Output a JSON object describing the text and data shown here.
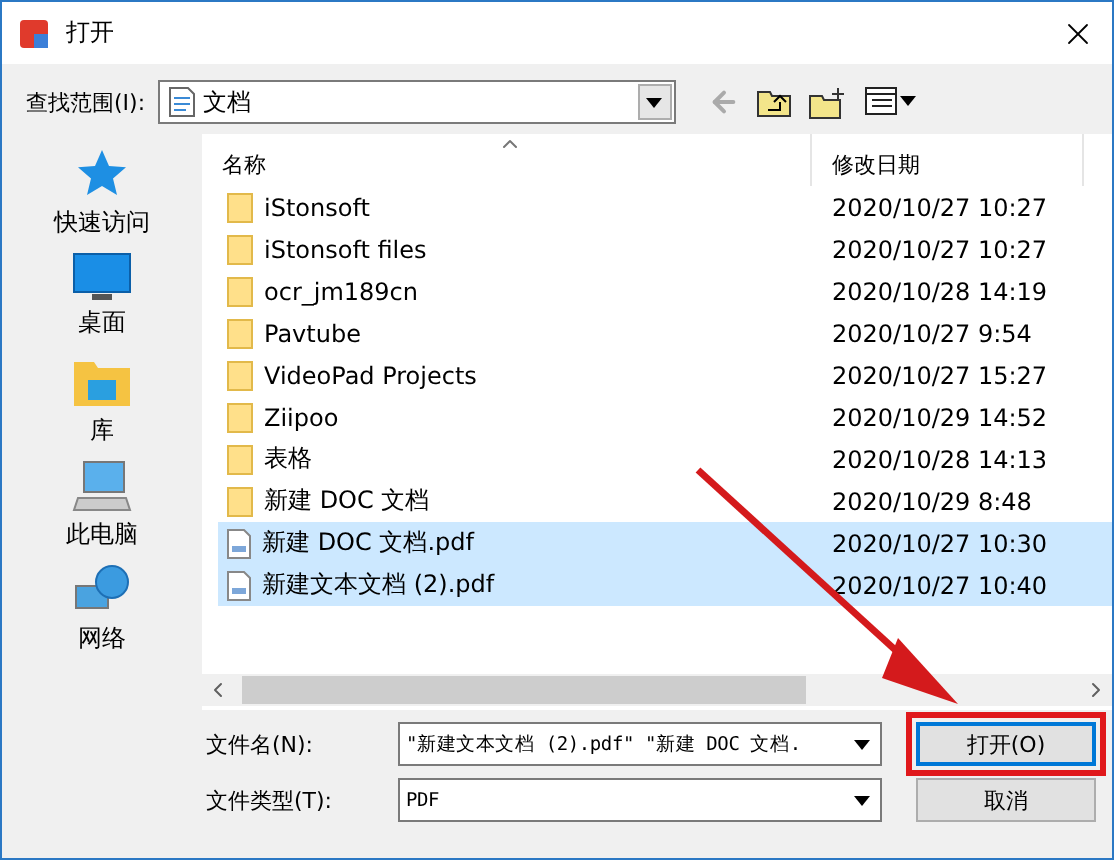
{
  "window": {
    "title": "打开"
  },
  "look_in": {
    "label": "查找范围(I):",
    "value": "文档"
  },
  "places": [
    {
      "label": "快速访问",
      "kind": "star"
    },
    {
      "label": "桌面",
      "kind": "desktop"
    },
    {
      "label": "库",
      "kind": "library"
    },
    {
      "label": "此电脑",
      "kind": "computer"
    },
    {
      "label": "网络",
      "kind": "network"
    }
  ],
  "columns": [
    {
      "label": "名称"
    },
    {
      "label": "修改日期"
    }
  ],
  "files": [
    {
      "name": "iStonsoft",
      "modified": "2020/10/27 10:27",
      "kind": "folder",
      "selected": false
    },
    {
      "name": "iStonsoft files",
      "modified": "2020/10/27 10:27",
      "kind": "folder",
      "selected": false
    },
    {
      "name": "ocr_jm189cn",
      "modified": "2020/10/28 14:19",
      "kind": "folder",
      "selected": false
    },
    {
      "name": "Pavtube",
      "modified": "2020/10/27 9:54",
      "kind": "folder",
      "selected": false
    },
    {
      "name": "VideoPad Projects",
      "modified": "2020/10/27 15:27",
      "kind": "folder",
      "selected": false
    },
    {
      "name": "Ziipoo",
      "modified": "2020/10/29 14:52",
      "kind": "folder",
      "selected": false
    },
    {
      "name": "表格",
      "modified": "2020/10/28 14:13",
      "kind": "folder",
      "selected": false
    },
    {
      "name": "新建 DOC 文档",
      "modified": "2020/10/29 8:48",
      "kind": "folder",
      "selected": false
    },
    {
      "name": "新建 DOC 文档.pdf",
      "modified": "2020/10/27 10:30",
      "kind": "pdf",
      "selected": true
    },
    {
      "name": "新建文本文档 (2).pdf",
      "modified": "2020/10/27 10:40",
      "kind": "pdf",
      "selected": true
    }
  ],
  "file_name": {
    "label": "文件名(N):",
    "value": "\"新建文本文档 (2).pdf\" \"新建 DOC 文档."
  },
  "file_type": {
    "label": "文件类型(T):",
    "value": "PDF"
  },
  "buttons": [
    {
      "label": "打开(O)",
      "marked": true
    },
    {
      "label": "取消",
      "marked": false
    }
  ]
}
